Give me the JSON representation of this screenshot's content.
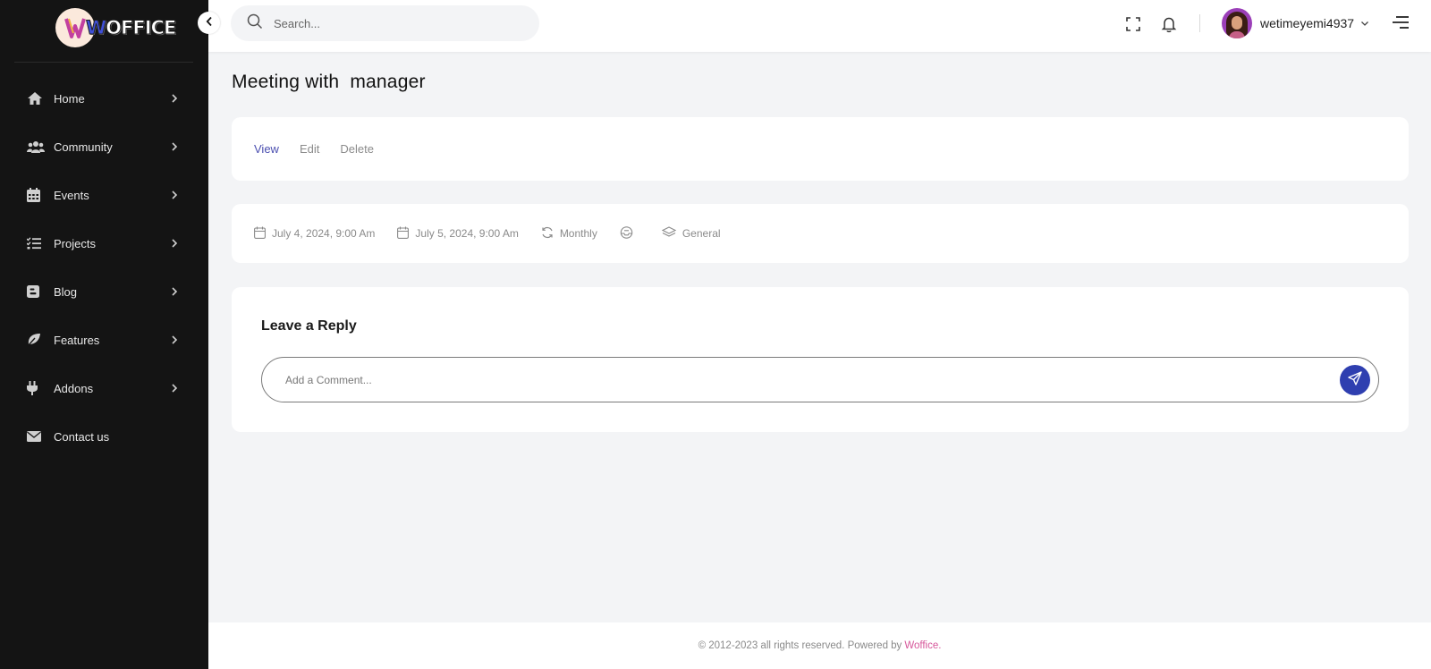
{
  "brand": {
    "logo_text_w": "W",
    "logo_text_rest": "OFFICE"
  },
  "sidebar": {
    "items": [
      {
        "label": "Home",
        "icon": "home-icon",
        "has_children": true
      },
      {
        "label": "Community",
        "icon": "users-icon",
        "has_children": true
      },
      {
        "label": "Events",
        "icon": "calendar-icon",
        "has_children": true
      },
      {
        "label": "Projects",
        "icon": "tasks-icon",
        "has_children": true
      },
      {
        "label": "Blog",
        "icon": "blog-icon",
        "has_children": true
      },
      {
        "label": "Features",
        "icon": "leaf-icon",
        "has_children": true
      },
      {
        "label": "Addons",
        "icon": "plug-icon",
        "has_children": true
      },
      {
        "label": "Contact us",
        "icon": "envelope-icon",
        "has_children": false
      }
    ]
  },
  "topbar": {
    "search_placeholder": "Search...",
    "username": "wetimeyemi4937"
  },
  "page": {
    "title": "Meeting with  manager"
  },
  "tabs": [
    {
      "label": "View",
      "active": true
    },
    {
      "label": "Edit",
      "active": false
    },
    {
      "label": "Delete",
      "active": false
    }
  ],
  "event_meta": {
    "start": "July 4, 2024, 9:00 Am",
    "end": "July 5, 2024, 9:00 Am",
    "repeat": "Monthly",
    "category": "General"
  },
  "reply": {
    "title": "Leave a Reply",
    "placeholder": "Add a Comment..."
  },
  "footer": {
    "text": "© 2012-2023 all rights reserved. Powered by",
    "brand": "Woffice."
  },
  "colors": {
    "sidebar_bg": "#141414",
    "accent": "#2f3fb0",
    "active_tab": "#4b4fb0",
    "footer_brand": "#d6569a",
    "page_bg": "#f3f4f6"
  }
}
